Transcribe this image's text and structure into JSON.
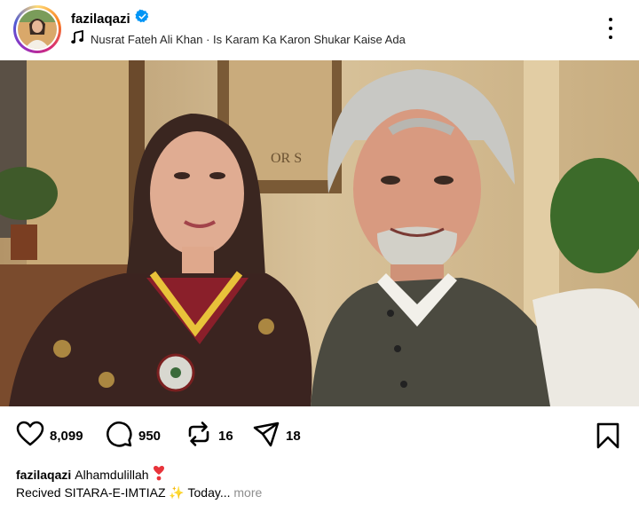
{
  "post": {
    "username": "fazilaqazi",
    "verified": true,
    "audio": "Nusrat Fateh Ali Khan · Is Karam Ka Karon Shukar Kaise Ada"
  },
  "actions": {
    "likes": "8,099",
    "comments": "950",
    "reposts": "16",
    "shares": "18"
  },
  "caption": {
    "username": "fazilaqazi",
    "line1": "Alhamdulillah",
    "line1_emoji": "heart-exclamation-icon",
    "line2": "Recived SITARA-E-IMTIAZ ✨ Today...",
    "more": "more"
  },
  "colors": {
    "verified": "#0095f6",
    "heart_emoji": "#e8333a",
    "muted": "#8e8e8e"
  },
  "icons": [
    "music-note-icon",
    "verified-badge-icon",
    "more-options-icon",
    "heart-icon",
    "comment-icon",
    "repost-icon",
    "share-icon",
    "bookmark-icon"
  ]
}
